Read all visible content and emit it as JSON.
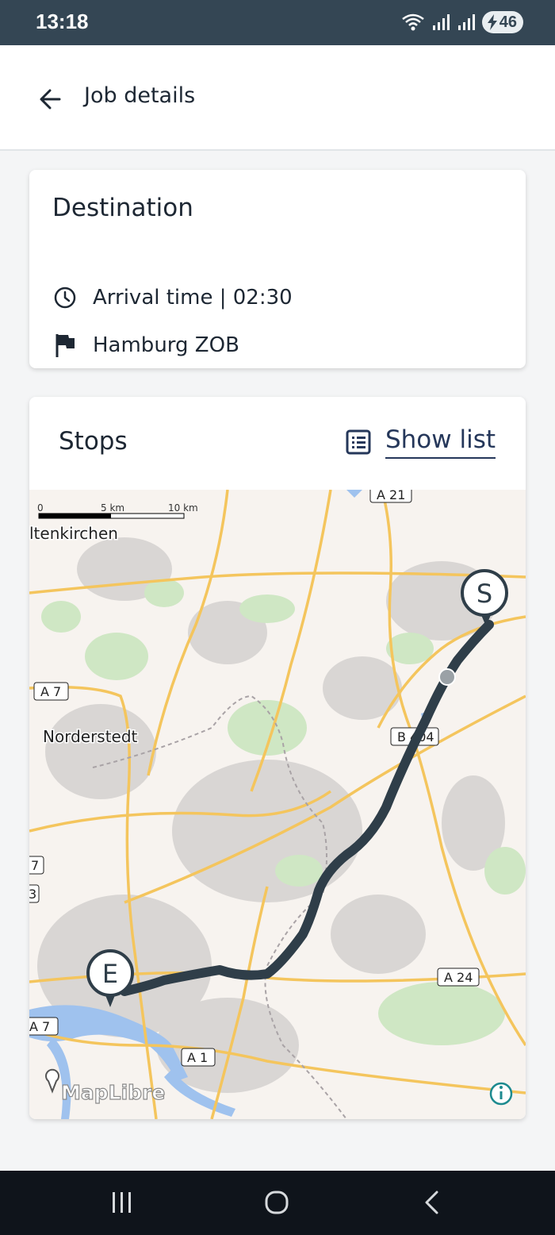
{
  "status_bar": {
    "time": "13:18",
    "battery_level": "46"
  },
  "app_bar": {
    "title": "Job details",
    "back_icon": "arrow-left-icon"
  },
  "destination": {
    "title": "Destination",
    "arrival_time": "Arrival time | 02:30",
    "place": "Hamburg ZOB"
  },
  "stops": {
    "title": "Stops",
    "show_list_label": "Show list"
  },
  "map": {
    "scale_labels": [
      "0",
      "5 km",
      "10 km"
    ],
    "place_labels": {
      "altenkirchen": "ltenkirchen",
      "norderstedt": "Norderstedt"
    },
    "road_labels": {
      "a21": "A 21",
      "a7_top": "A 7",
      "b404": "B 404",
      "a7_left1": "7",
      "a7_left2": "3",
      "a24": "A 24",
      "a7_bottom": "A 7",
      "a1": "A 1"
    },
    "start_marker": "S",
    "end_marker": "E",
    "attribution": "MapLibre",
    "route_color": "#2f3e49"
  }
}
